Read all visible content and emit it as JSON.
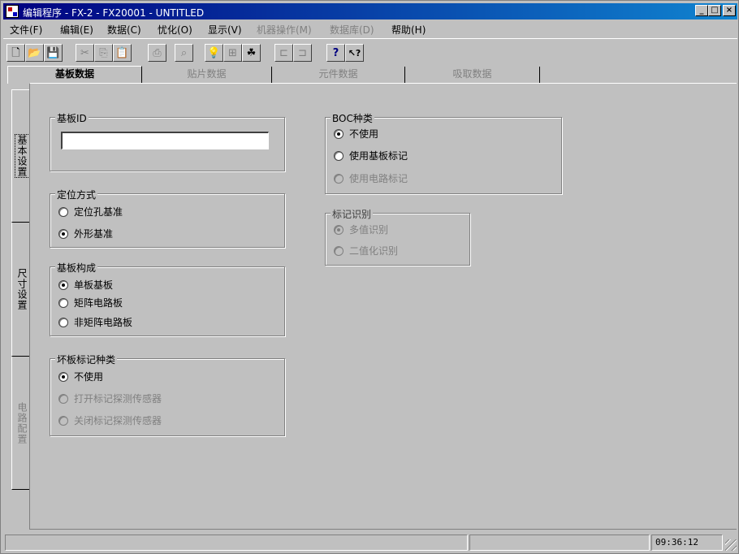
{
  "window": {
    "title": "编辑程序 - FX-2 - FX20001 - UNTITLED",
    "minimize": "_",
    "maximize": "□",
    "close": "×"
  },
  "menu": [
    {
      "label": "文件(F)",
      "enabled": true
    },
    {
      "label": "编辑(E)",
      "enabled": true
    },
    {
      "label": "数据(C)",
      "enabled": true
    },
    {
      "label": "忧化(O)",
      "enabled": true
    },
    {
      "label": "显示(V)",
      "enabled": true
    },
    {
      "label": "机器操作(M)",
      "enabled": false
    },
    {
      "label": "数据库(D)",
      "enabled": false
    },
    {
      "label": "帮助(H)",
      "enabled": true
    }
  ],
  "toolbar": [
    {
      "icon": "new-file-icon",
      "glyph": "🗋",
      "enabled": true
    },
    {
      "icon": "open-folder-icon",
      "glyph": "📂",
      "enabled": true
    },
    {
      "icon": "save-icon",
      "glyph": "💾",
      "enabled": true
    },
    {
      "icon": "cut-icon",
      "glyph": "✂",
      "enabled": false
    },
    {
      "icon": "copy-icon",
      "glyph": "⎘",
      "enabled": false
    },
    {
      "icon": "paste-icon",
      "glyph": "📋",
      "enabled": false
    },
    {
      "icon": "print-icon",
      "glyph": "⎙",
      "enabled": false
    },
    {
      "icon": "find-icon",
      "glyph": "⌕",
      "enabled": false
    },
    {
      "icon": "lightbulb-icon",
      "glyph": "💡",
      "enabled": true
    },
    {
      "icon": "tree-icon",
      "glyph": "⊞",
      "enabled": false
    },
    {
      "icon": "components-icon",
      "glyph": "☘",
      "enabled": true
    },
    {
      "icon": "align-left-icon",
      "glyph": "⊏",
      "enabled": false
    },
    {
      "icon": "align-right-icon",
      "glyph": "⊐",
      "enabled": false
    },
    {
      "icon": "help-icon",
      "glyph": "?",
      "enabled": true
    },
    {
      "icon": "context-help-icon",
      "glyph": "↖?",
      "enabled": true
    }
  ],
  "top_tabs": [
    {
      "label": "基板数据",
      "active": true,
      "enabled": true
    },
    {
      "label": "贴片数据",
      "active": false,
      "enabled": false
    },
    {
      "label": "元件数据",
      "active": false,
      "enabled": false
    },
    {
      "label": "吸取数据",
      "active": false,
      "enabled": false
    }
  ],
  "side_tabs": [
    {
      "label": "基本设置",
      "active": true,
      "enabled": true
    },
    {
      "label": "尺寸设置",
      "active": false,
      "enabled": true
    },
    {
      "label": "电路配置",
      "active": false,
      "enabled": false
    }
  ],
  "board_id": {
    "title": "基板ID",
    "value": ""
  },
  "positioning": {
    "title": "定位方式",
    "options": [
      {
        "label": "定位孔基准",
        "checked": false,
        "enabled": true
      },
      {
        "label": "外形基准",
        "checked": true,
        "enabled": true
      }
    ]
  },
  "board_structure": {
    "title": "基板构成",
    "options": [
      {
        "label": "单板基板",
        "checked": true,
        "enabled": true
      },
      {
        "label": "矩阵电路板",
        "checked": false,
        "enabled": true
      },
      {
        "label": "非矩阵电路板",
        "checked": false,
        "enabled": true
      }
    ]
  },
  "bad_mark": {
    "title": "坏板标记种类",
    "options": [
      {
        "label": "不使用",
        "checked": true,
        "enabled": true
      },
      {
        "label": "打开标记探测传感器",
        "checked": false,
        "enabled": false
      },
      {
        "label": "关闭标记探测传感器",
        "checked": false,
        "enabled": false
      }
    ]
  },
  "boc": {
    "title": "BOC种类",
    "options": [
      {
        "label": "不使用",
        "checked": true,
        "enabled": true
      },
      {
        "label": "使用基板标记",
        "checked": false,
        "enabled": true
      },
      {
        "label": "使用电路标记",
        "checked": false,
        "enabled": false
      }
    ]
  },
  "mark_recognition": {
    "title": "标记识别",
    "options": [
      {
        "label": "多值识别",
        "checked": true,
        "enabled": false
      },
      {
        "label": "二值化识别",
        "checked": false,
        "enabled": false
      }
    ]
  },
  "status": {
    "message": "",
    "info": "",
    "time": "09:36:12"
  }
}
